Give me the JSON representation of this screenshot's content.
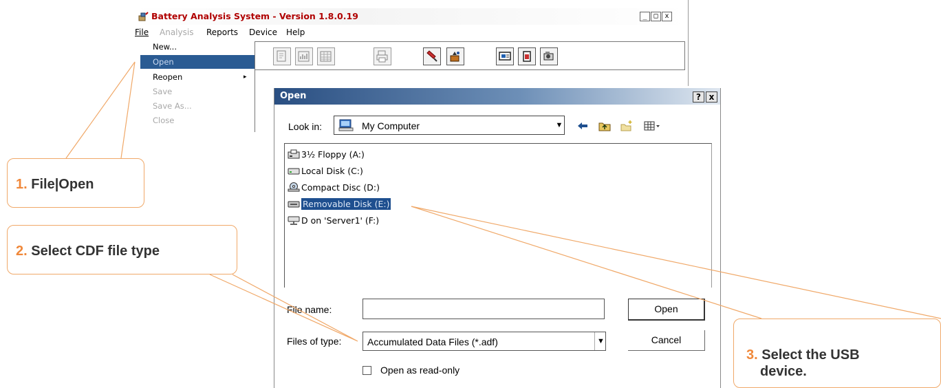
{
  "app": {
    "title": "Battery Analysis System - Version 1.8.0.19",
    "window_controls": [
      "_",
      "□",
      "x"
    ],
    "menu": [
      {
        "label": "File",
        "disabled": false
      },
      {
        "label": "Analysis",
        "disabled": true
      },
      {
        "label": "Reports",
        "disabled": false
      },
      {
        "label": "Device",
        "disabled": false
      },
      {
        "label": "Help",
        "disabled": false
      }
    ],
    "file_menu": [
      {
        "label": "New...",
        "state": "normal"
      },
      {
        "label": "Open",
        "state": "selected"
      },
      {
        "label": "Reopen",
        "state": "normal",
        "submenu": "▸"
      },
      {
        "label": "Save",
        "state": "disabled"
      },
      {
        "label": "Save As...",
        "state": "disabled"
      },
      {
        "label": "Close",
        "state": "disabled"
      }
    ],
    "toolbar_icons": [
      "new-test-icon",
      "chart-icon",
      "table-icon",
      "print-icon",
      "probe-icon",
      "device-icon",
      "monitor-icon",
      "battery-icon",
      "camera-icon"
    ]
  },
  "dialog": {
    "title": "Open",
    "help_button": "?",
    "close_button": "x",
    "look_in_label": "Look in:",
    "look_in_value": "My Computer",
    "dropdown_arrow": "▼",
    "nav_icons": [
      "back-arrow-icon",
      "up-folder-icon",
      "new-folder-icon",
      "view-menu-icon"
    ],
    "drives": [
      {
        "label": "3½ Floppy (A:)",
        "icon": "floppy-drive-icon",
        "selected": false
      },
      {
        "label": "Local Disk (C:)",
        "icon": "hard-disk-icon",
        "selected": false
      },
      {
        "label": "Compact Disc (D:)",
        "icon": "cd-drive-icon",
        "selected": false
      },
      {
        "label": "Removable Disk (E:)",
        "icon": "removable-disk-icon",
        "selected": true
      },
      {
        "label": "D on 'Server1' (F:)",
        "icon": "network-drive-icon",
        "selected": false
      }
    ],
    "file_name_label": "File name:",
    "file_name_value": "",
    "files_of_type_label": "Files of type:",
    "files_of_type_value": "Accumulated Data Files (*.adf)",
    "read_only_label": "Open as read-only",
    "read_only_checked": false,
    "open_button": "Open",
    "cancel_button": "Cancel"
  },
  "callouts": [
    {
      "num": "1.",
      "text": "File|Open"
    },
    {
      "num": "2.",
      "text": "Select CDF file type"
    },
    {
      "num": "3.",
      "text_line1": "Select the USB",
      "text_line2": "device."
    }
  ],
  "colors": {
    "selection": "#2a5b93",
    "dialog_title_gradient_start": "#2a4f82",
    "callout_border": "#f0a868",
    "callout_number": "#f0883a",
    "leader_line": "#f0a868",
    "app_title": "#b00000"
  }
}
